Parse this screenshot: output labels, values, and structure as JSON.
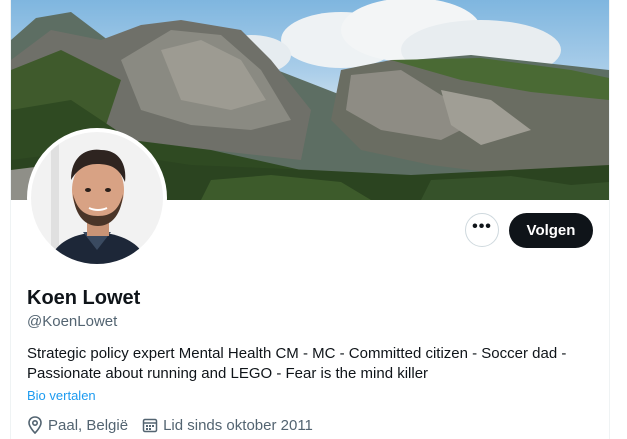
{
  "profile": {
    "name": "Koen Lowet",
    "handle": "@KoenLowet",
    "bio_line1": "Strategic policy expert Mental Health CM - MC - Committed citizen - Soccer dad -",
    "bio_line2": "Passionate about running and LEGO - Fear is the mind killer",
    "translate_bio": "Bio vertalen",
    "location": "Paal, België",
    "joined": "Lid sinds oktober 2011"
  },
  "actions": {
    "more_label": "•••",
    "follow_label": "Volgen"
  },
  "icons": {
    "location": "location-pin-icon",
    "joined": "calendar-icon",
    "more": "more-options-icon"
  },
  "colors": {
    "follow_bg": "#0f1419",
    "link": "#1d9bf0",
    "secondary_text": "#536471"
  }
}
